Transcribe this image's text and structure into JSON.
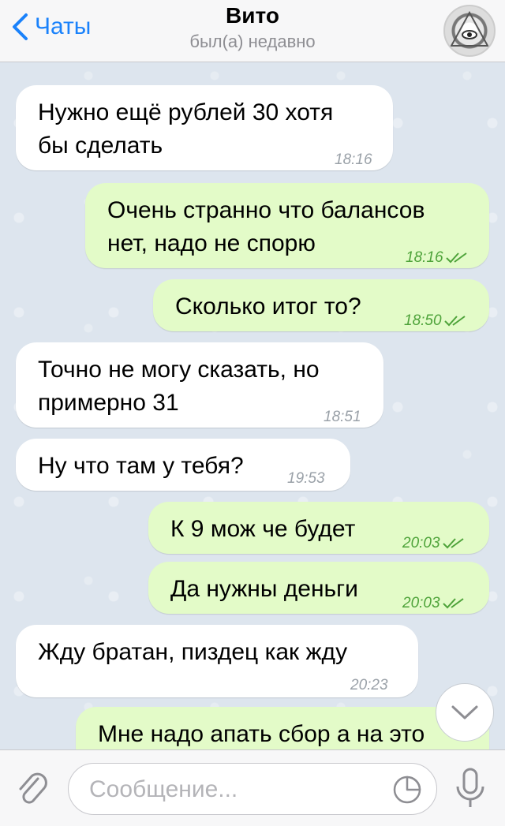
{
  "header": {
    "back_label": "Чаты",
    "title": "Вито",
    "status": "был(а) недавно"
  },
  "messages": [
    {
      "direction": "in",
      "text_lines": [
        "Нужно ещё рублей 30 хотя",
        "бы сделать"
      ],
      "time": "18:16"
    },
    {
      "direction": "out",
      "text_lines": [
        "Очень странно что балансов",
        "нет, надо не спорю"
      ],
      "time": "18:16",
      "read": true
    },
    {
      "direction": "out",
      "text_lines": [
        "Сколько итог то?"
      ],
      "time": "18:50",
      "read": true
    },
    {
      "direction": "in",
      "text_lines": [
        "Точно не могу сказать, но",
        "примерно 31"
      ],
      "time": "18:51"
    },
    {
      "direction": "in",
      "text_lines": [
        "Ну что там у тебя?"
      ],
      "time": "19:53"
    },
    {
      "direction": "out",
      "text_lines": [
        "К 9 мож че будет"
      ],
      "time": "20:03",
      "read": true
    },
    {
      "direction": "out",
      "text_lines": [
        "Да нужны деньги"
      ],
      "time": "20:03",
      "read": true
    },
    {
      "direction": "in",
      "text_lines": [
        "Жду братан, пиздец как жду"
      ],
      "time": "20:23"
    },
    {
      "direction": "out",
      "text_lines": [
        "Мне надо апать сбор а на это"
      ],
      "time": ""
    }
  ],
  "input": {
    "placeholder": "Сообщение..."
  },
  "colors": {
    "accent": "#1a82fb",
    "outgoing_bubble": "#e3fbc8",
    "incoming_bubble": "#ffffff",
    "read_check": "#4ea33a"
  },
  "icons": {
    "back": "chevron-left-icon",
    "attach": "paperclip-icon",
    "sticker": "sticker-icon",
    "mic": "microphone-icon",
    "scroll": "chevron-down-icon"
  }
}
